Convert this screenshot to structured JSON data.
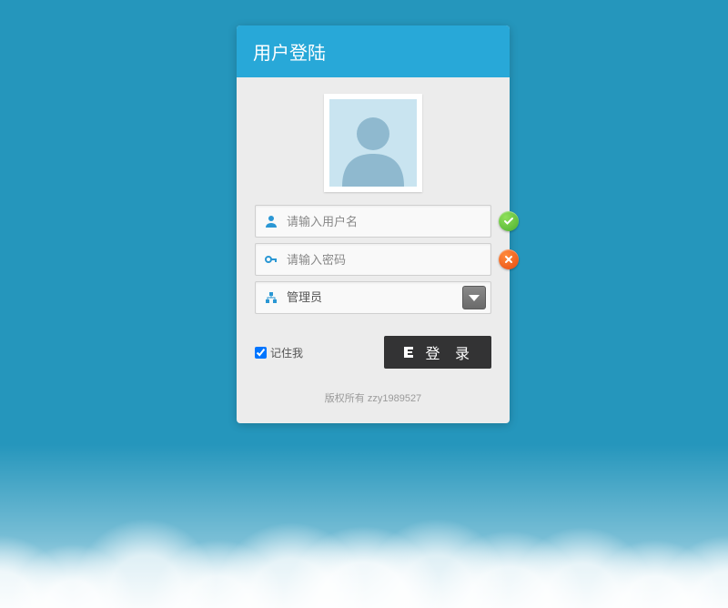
{
  "header": {
    "title": "用户登陆"
  },
  "form": {
    "username": {
      "placeholder": "请输入用户名",
      "value": "",
      "status": "ok"
    },
    "password": {
      "placeholder": "请输入密码",
      "value": "",
      "status": "error"
    },
    "role": {
      "label": "管理员"
    },
    "remember": {
      "label": "记住我",
      "checked": true
    },
    "submit": {
      "label": "登 录"
    }
  },
  "footer": {
    "copyright": "版权所有 zzy1989527"
  },
  "colors": {
    "accent": "#28a8d8",
    "button": "#333334",
    "ok": "#4caf2f",
    "error": "#e84b12"
  }
}
